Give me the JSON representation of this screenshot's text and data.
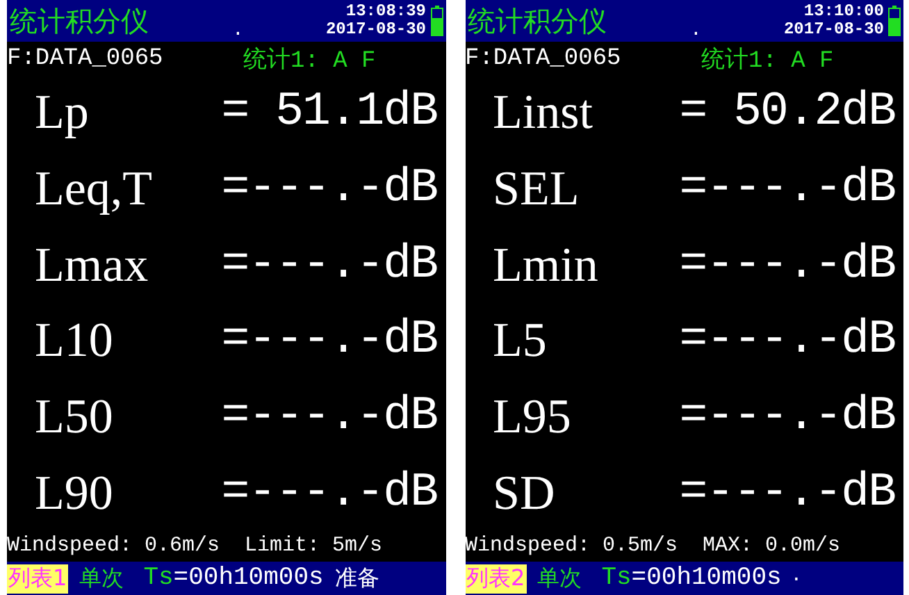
{
  "screens": [
    {
      "title": "统计积分仪",
      "indicator": ".",
      "time": "13:08:39",
      "date": "2017-08-30",
      "file": "F:DATA_0065",
      "mode": "统计1: A F",
      "readings": [
        {
          "name": "Lp",
          "value": "= 51.1dB"
        },
        {
          "name": "Leq,T",
          "value": "=---.-dB"
        },
        {
          "name": "Lmax",
          "value": "=---.-dB"
        },
        {
          "name": "L10",
          "value": "=---.-dB"
        },
        {
          "name": "L50",
          "value": "=---.-dB"
        },
        {
          "name": "L90",
          "value": "=---.-dB"
        }
      ],
      "wind": "Windspeed: 0.6m/s  Limit: 5m/s",
      "list": "列表1",
      "single": "单次",
      "ts_label": "Ts",
      "ts_value": "=00h10m00s",
      "status": "准备"
    },
    {
      "title": "统计积分仪",
      "indicator": ".",
      "time": "13:10:00",
      "date": "2017-08-30",
      "file": "F:DATA_0065",
      "mode": "统计1: A F",
      "readings": [
        {
          "name": "Linst",
          "value": "= 50.2dB"
        },
        {
          "name": "SEL",
          "value": "=---.-dB"
        },
        {
          "name": "Lmin",
          "value": "=---.-dB"
        },
        {
          "name": "L5",
          "value": "=---.-dB"
        },
        {
          "name": "L95",
          "value": "=---.-dB"
        },
        {
          "name": "SD",
          "value": "=---.-dB"
        }
      ],
      "wind": "Windspeed: 0.5m/s  MAX: 0.0m/s",
      "list": "列表2",
      "single": "单次",
      "ts_label": "Ts",
      "ts_value": "=00h10m00s",
      "status": "·"
    }
  ]
}
